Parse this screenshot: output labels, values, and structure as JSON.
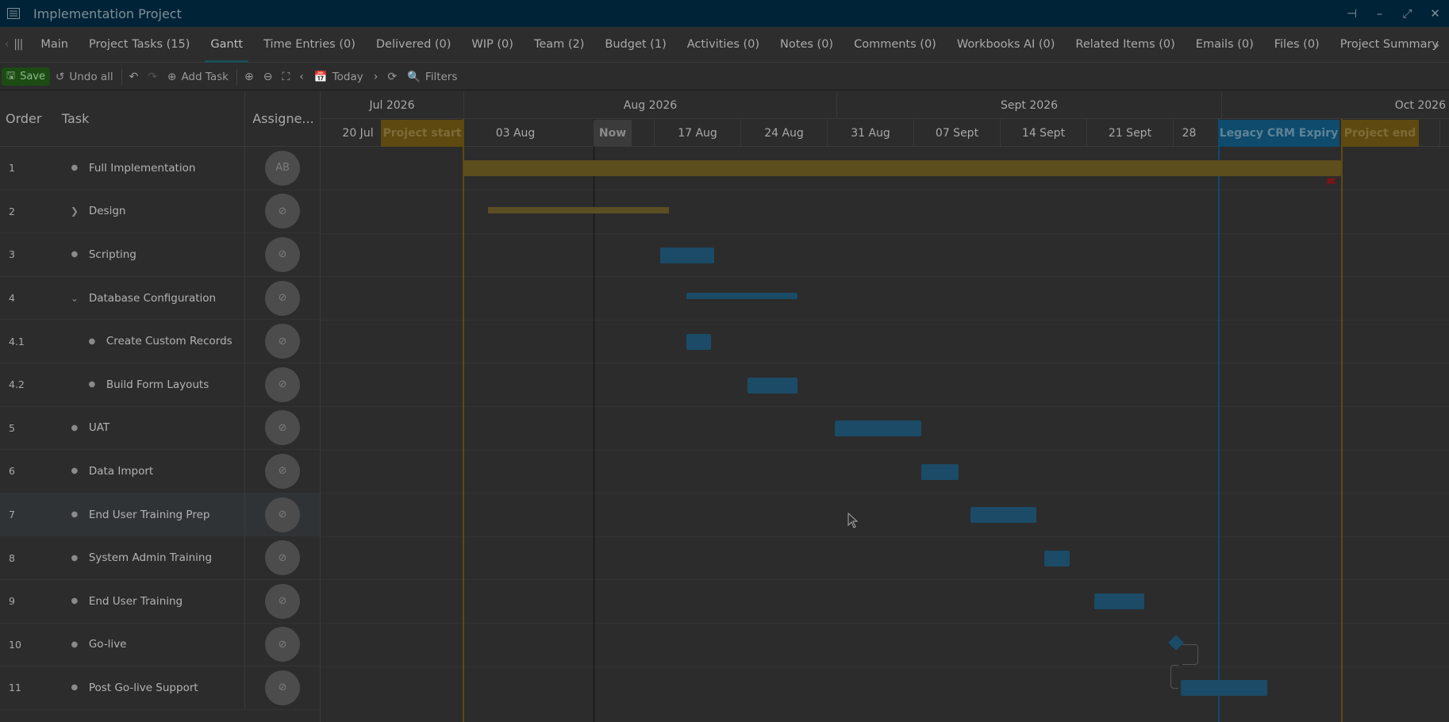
{
  "window": {
    "title": "Implementation Project",
    "app_icon": "list-icon",
    "controls": [
      "pin-icon",
      "minimize-icon",
      "restore-icon",
      "close-icon"
    ]
  },
  "tabs": [
    {
      "label": "Main"
    },
    {
      "label": "Project Tasks (15)"
    },
    {
      "label": "Gantt",
      "active": true
    },
    {
      "label": "Time Entries (0)"
    },
    {
      "label": "Delivered (0)"
    },
    {
      "label": "WIP (0)"
    },
    {
      "label": "Team (2)"
    },
    {
      "label": "Budget (1)"
    },
    {
      "label": "Activities (0)"
    },
    {
      "label": "Notes (0)"
    },
    {
      "label": "Comments (0)"
    },
    {
      "label": "Workbooks AI (0)"
    },
    {
      "label": "Related Items (0)"
    },
    {
      "label": "Emails (0)"
    },
    {
      "label": "Files (0)"
    },
    {
      "label": "Project Summary"
    }
  ],
  "toolbar": {
    "save": "Save",
    "undo_all": "Undo all",
    "add_task": "Add Task",
    "today": "Today",
    "filters": "Filters"
  },
  "grid": {
    "headers": {
      "order": "Order",
      "task": "Task",
      "assignee": "Assigne..."
    },
    "rows": [
      {
        "order": "1",
        "task": "Full Implementation",
        "kind": "bullet",
        "avatar": "AB"
      },
      {
        "order": "2",
        "task": "Design",
        "kind": "collapsed"
      },
      {
        "order": "3",
        "task": "Scripting",
        "kind": "bullet"
      },
      {
        "order": "4",
        "task": "Database Configuration",
        "kind": "expanded"
      },
      {
        "order": "4.1",
        "task": "Create Custom Records",
        "kind": "child"
      },
      {
        "order": "4.2",
        "task": "Build Form Layouts",
        "kind": "child"
      },
      {
        "order": "5",
        "task": "UAT",
        "kind": "bullet"
      },
      {
        "order": "6",
        "task": "Data Import",
        "kind": "bullet"
      },
      {
        "order": "7",
        "task": "End User Training Prep",
        "kind": "bullet",
        "highlight": true
      },
      {
        "order": "8",
        "task": "System Admin Training",
        "kind": "bullet"
      },
      {
        "order": "9",
        "task": "End User Training",
        "kind": "bullet"
      },
      {
        "order": "10",
        "task": "Go-live",
        "kind": "bullet"
      },
      {
        "order": "11",
        "task": "Post Go-live Support",
        "kind": "bullet"
      }
    ]
  },
  "timeline": {
    "months": [
      "Jul 2026",
      "Aug 2026",
      "Sept 2026",
      "Oct 2026"
    ],
    "weeks": [
      "20 Jul",
      "03 Aug",
      "17 Aug",
      "24 Aug",
      "31 Aug",
      "07 Sept",
      "14 Sept",
      "21 Sept",
      "28"
    ],
    "markers": {
      "project_start": "Project start",
      "now": "Now",
      "legacy": "Legacy CRM Expiry",
      "project_end": "Project end"
    },
    "colors": {
      "project_start": "#5e4a10",
      "now": "#3e3e3e",
      "legacy": "#0e4b6d",
      "project_end": "#5e4a10",
      "task_bar": "#1b4b67",
      "summary_bar": "#5d4e1d"
    }
  }
}
